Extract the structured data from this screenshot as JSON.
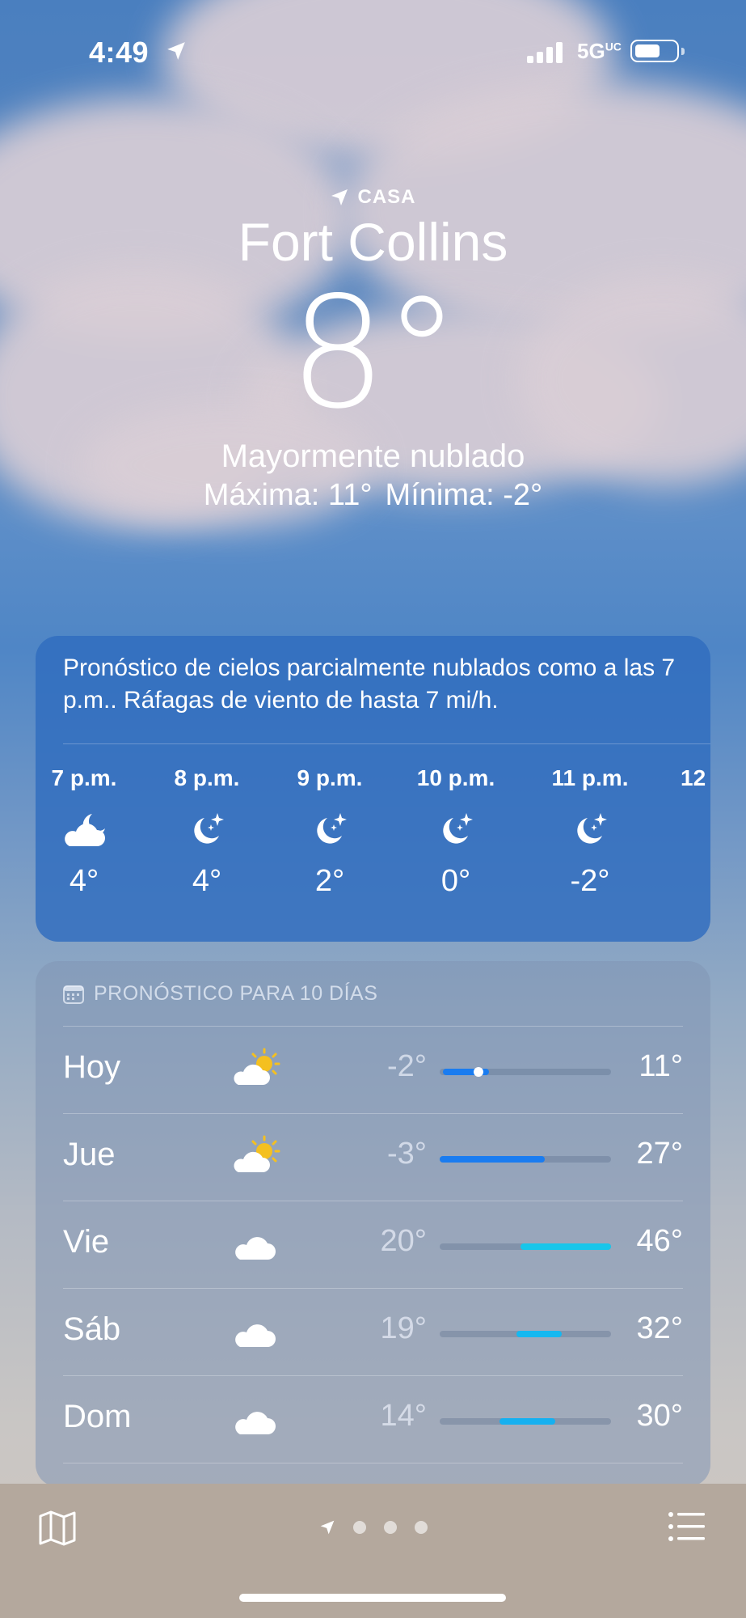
{
  "status_bar": {
    "time": "4:49",
    "network": "5G",
    "network_sup": "UC"
  },
  "location": {
    "label": "CASA",
    "city": "Fort Collins"
  },
  "current": {
    "temp": "8°",
    "condition": "Mayormente nublado",
    "high": "Máxima: 11°",
    "low": "Mínima: -2°"
  },
  "hourly": {
    "summary": "Pronóstico de cielos parcialmente nublados como a las 7 p.m.. Ráfagas de viento de hasta 7 mi/h.",
    "items": [
      {
        "time": "7 p.m.",
        "icon": "moon-cloud-icon",
        "temp": "4°"
      },
      {
        "time": "8 p.m.",
        "icon": "moon-stars-icon",
        "temp": "4°"
      },
      {
        "time": "9 p.m.",
        "icon": "moon-stars-icon",
        "temp": "2°"
      },
      {
        "time": "10 p.m.",
        "icon": "moon-stars-icon",
        "temp": "0°"
      },
      {
        "time": "11 p.m.",
        "icon": "moon-stars-icon",
        "temp": "-2°"
      },
      {
        "time": "12",
        "icon": "moon-stars-icon",
        "temp": ""
      }
    ]
  },
  "daily": {
    "title": "PRONÓSTICO PARA 10 DÍAS",
    "range_min": -3,
    "range_max": 46,
    "items": [
      {
        "day": "Hoy",
        "icon": "sun-cloud-icon",
        "low": "-2°",
        "high": "11°",
        "low_val": -2,
        "high_val": 11,
        "current_val": 8,
        "bar_color": "#1a7cf0"
      },
      {
        "day": "Jue",
        "icon": "sun-cloud-icon",
        "low": "-3°",
        "high": "27°",
        "low_val": -3,
        "high_val": 27,
        "bar_color": "#1a7cf0"
      },
      {
        "day": "Vie",
        "icon": "cloud-icon",
        "low": "20°",
        "high": "46°",
        "low_val": 20,
        "high_val": 46,
        "bar_color": "#18c6ea"
      },
      {
        "day": "Sáb",
        "icon": "cloud-icon",
        "low": "19°",
        "high": "32°",
        "low_val": 19,
        "high_val": 32,
        "bar_color": "#15b8f0"
      },
      {
        "day": "Dom",
        "icon": "cloud-icon",
        "low": "14°",
        "high": "30°",
        "low_val": 14,
        "high_val": 30,
        "bar_color": "#15b0f0"
      }
    ]
  },
  "colors": {
    "sun": "#f4c020",
    "accent_blue": "#1a7cf0",
    "accent_cyan": "#18c6ea"
  }
}
